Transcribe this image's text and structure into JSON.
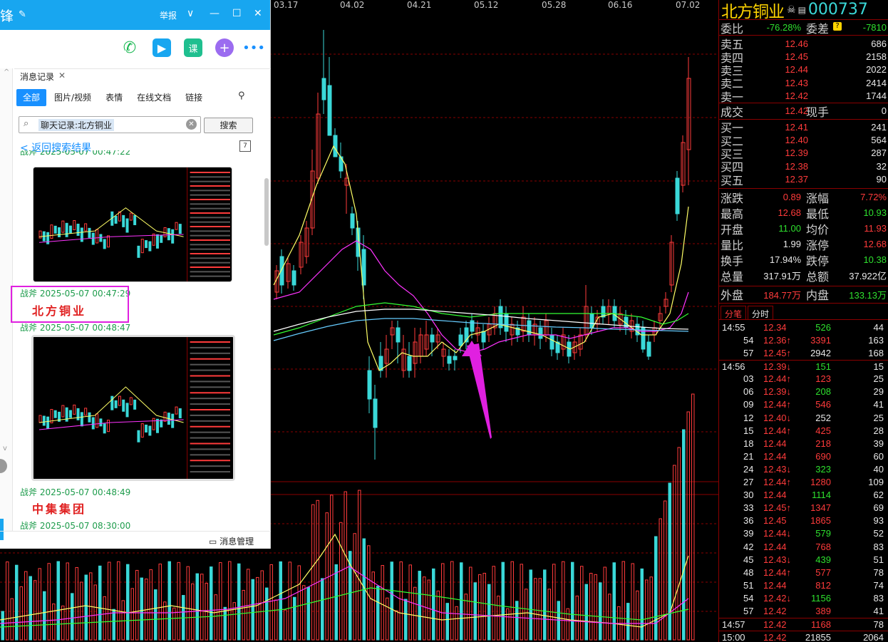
{
  "chart": {
    "dates": [
      "03.17",
      "04.02",
      "04.21",
      "05.12",
      "05.28",
      "06.16",
      "07.02"
    ],
    "colors": {
      "up": "#ff3b3b",
      "down": "#3ad8d8",
      "ma5": "#ffff66",
      "ma10": "#ff33ff",
      "ma20": "#33ff33",
      "ma60": "#ffffff",
      "ma120": "#66ccff",
      "arrow": "#e020e0"
    }
  },
  "stock": {
    "name": "北方铜业",
    "code": "000737",
    "skull_icon": "skull-icon",
    "weibi_label": "委比",
    "weibi_value": "-76.28%",
    "weicha_label": "委差",
    "weicha_value": "-7810",
    "sell": [
      {
        "label": "卖五",
        "price": "12.46",
        "vol": "686"
      },
      {
        "label": "卖四",
        "price": "12.45",
        "vol": "2158"
      },
      {
        "label": "卖三",
        "price": "12.44",
        "vol": "2022"
      },
      {
        "label": "卖二",
        "price": "12.43",
        "vol": "2414"
      },
      {
        "label": "卖一",
        "price": "12.42",
        "vol": "1744"
      }
    ],
    "deal_label": "成交",
    "deal_price": "12.42",
    "hand_label": "现手",
    "hand_value": "0",
    "buy": [
      {
        "label": "买一",
        "price": "12.41",
        "vol": "241"
      },
      {
        "label": "买二",
        "price": "12.40",
        "vol": "564"
      },
      {
        "label": "买三",
        "price": "12.39",
        "vol": "287"
      },
      {
        "label": "买四",
        "price": "12.38",
        "vol": "32"
      },
      {
        "label": "买五",
        "price": "12.37",
        "vol": "90"
      }
    ],
    "stats": [
      {
        "l1": "涨跌",
        "v1": "0.89",
        "c1": "red",
        "l2": "涨幅",
        "v2": "7.72%",
        "c2": "red"
      },
      {
        "l1": "最高",
        "v1": "12.68",
        "c1": "red",
        "l2": "最低",
        "v2": "10.93",
        "c2": "green"
      },
      {
        "l1": "开盘",
        "v1": "11.00",
        "c1": "green",
        "l2": "均价",
        "v2": "11.93",
        "c2": "red"
      },
      {
        "l1": "量比",
        "v1": "1.99",
        "c1": "white",
        "l2": "涨停",
        "v2": "12.68",
        "c2": "red"
      },
      {
        "l1": "换手",
        "v1": "17.94%",
        "c1": "white",
        "l2": "跌停",
        "v2": "10.38",
        "c2": "green"
      },
      {
        "l1": "总量",
        "v1": "317.91万",
        "c1": "white",
        "l2": "总额",
        "v2": "37.922亿",
        "c2": "white"
      }
    ],
    "outer_label": "外盘",
    "outer_value": "184.77万",
    "inner_label": "内盘",
    "inner_value": "133.13万",
    "tab_ticks": "分笔",
    "tab_time": "分时",
    "ticks": [
      {
        "t": "14:55",
        "p": "12.34",
        "pa": "",
        "pc": "red",
        "v": "526",
        "vc": "green",
        "n": "44"
      },
      {
        "t": "54",
        "p": "12.36",
        "pa": "↑",
        "pc": "red",
        "v": "3391",
        "vc": "red",
        "n": "163"
      },
      {
        "t": "57",
        "p": "12.45",
        "pa": "↑",
        "pc": "red",
        "v": "2942",
        "vc": "white",
        "n": "168"
      },
      {
        "t": "14:56",
        "p": "12.39",
        "pa": "↓",
        "pc": "red",
        "v": "151",
        "vc": "green",
        "n": "15"
      },
      {
        "t": "03",
        "p": "12.44",
        "pa": "↑",
        "pc": "red",
        "v": "123",
        "vc": "red",
        "n": "25"
      },
      {
        "t": "06",
        "p": "12.39",
        "pa": "↓",
        "pc": "red",
        "v": "208",
        "vc": "green",
        "n": "29"
      },
      {
        "t": "09",
        "p": "12.44",
        "pa": "↑",
        "pc": "red",
        "v": "546",
        "vc": "red",
        "n": "41"
      },
      {
        "t": "12",
        "p": "12.40",
        "pa": "↓",
        "pc": "red",
        "v": "252",
        "vc": "white",
        "n": "25"
      },
      {
        "t": "15",
        "p": "12.44",
        "pa": "↑",
        "pc": "red",
        "v": "425",
        "vc": "red",
        "n": "28"
      },
      {
        "t": "18",
        "p": "12.44",
        "pa": "",
        "pc": "red",
        "v": "218",
        "vc": "red",
        "n": "39"
      },
      {
        "t": "21",
        "p": "12.44",
        "pa": "",
        "pc": "red",
        "v": "690",
        "vc": "red",
        "n": "60"
      },
      {
        "t": "24",
        "p": "12.43",
        "pa": "↓",
        "pc": "red",
        "v": "323",
        "vc": "green",
        "n": "40"
      },
      {
        "t": "27",
        "p": "12.44",
        "pa": "↑",
        "pc": "red",
        "v": "1280",
        "vc": "red",
        "n": "109"
      },
      {
        "t": "30",
        "p": "12.44",
        "pa": "",
        "pc": "red",
        "v": "1114",
        "vc": "green",
        "n": "62"
      },
      {
        "t": "33",
        "p": "12.45",
        "pa": "↑",
        "pc": "red",
        "v": "1347",
        "vc": "red",
        "n": "69"
      },
      {
        "t": "36",
        "p": "12.45",
        "pa": "",
        "pc": "red",
        "v": "1865",
        "vc": "red",
        "n": "93"
      },
      {
        "t": "39",
        "p": "12.44",
        "pa": "↓",
        "pc": "red",
        "v": "579",
        "vc": "green",
        "n": "52"
      },
      {
        "t": "42",
        "p": "12.44",
        "pa": "",
        "pc": "red",
        "v": "768",
        "vc": "red",
        "n": "83"
      },
      {
        "t": "45",
        "p": "12.43",
        "pa": "↓",
        "pc": "red",
        "v": "439",
        "vc": "green",
        "n": "51"
      },
      {
        "t": "48",
        "p": "12.44",
        "pa": "↑",
        "pc": "red",
        "v": "577",
        "vc": "red",
        "n": "78"
      },
      {
        "t": "51",
        "p": "12.44",
        "pa": "",
        "pc": "red",
        "v": "812",
        "vc": "red",
        "n": "74"
      },
      {
        "t": "54",
        "p": "12.42",
        "pa": "↓",
        "pc": "red",
        "v": "1156",
        "vc": "green",
        "n": "83"
      },
      {
        "t": "57",
        "p": "12.42",
        "pa": "",
        "pc": "red",
        "v": "389",
        "vc": "red",
        "n": "41"
      },
      {
        "t": "14:57",
        "p": "12.42",
        "pa": "",
        "pc": "red",
        "v": "1168",
        "vc": "red",
        "n": "78"
      },
      {
        "t": "15:00",
        "p": "12.42",
        "pa": "",
        "pc": "red",
        "v": "21855",
        "vc": "white",
        "n": "2064"
      }
    ]
  },
  "chat": {
    "title": "锋",
    "report": "举报",
    "records_tab": "消息记录",
    "filters": [
      "全部",
      "图片/视频",
      "表情",
      "在线文档",
      "链接"
    ],
    "search_value": "聊天记录:北方铜业",
    "search_button": "搜索",
    "back_link": "< 返回搜索结果",
    "cut_meta": "战斧 2025-05-07 00:47:22",
    "items": [
      {
        "meta": "战斧 2025-05-07 00:47:29",
        "note": "北方铜业"
      },
      {
        "meta": "战斧 2025-05-07 00:48:47",
        "note": ""
      },
      {
        "meta": "战斧 2025-05-07 00:48:49",
        "note": "中集集团"
      },
      {
        "meta": "战斧 2025-05-07 08:30:00",
        "note": ""
      }
    ],
    "footer": "消息管理",
    "calendar": "7"
  }
}
